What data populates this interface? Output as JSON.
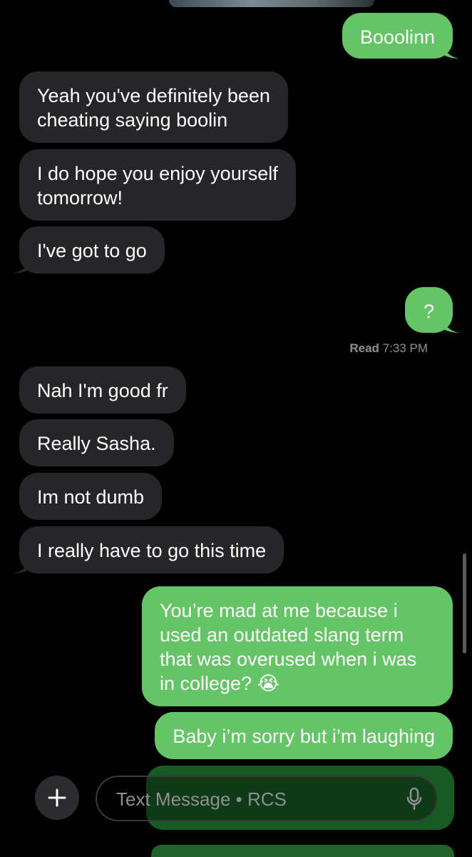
{
  "messages": [
    {
      "side": "sent",
      "text": "Booolinn"
    },
    {
      "side": "received",
      "text": "Yeah you've definitely been\ncheating saying boolin"
    },
    {
      "side": "received",
      "text": "I do hope you enjoy yourself\ntomorrow!"
    },
    {
      "side": "received",
      "text": "I've got to go"
    },
    {
      "side": "sent",
      "text": "?"
    },
    {
      "side": "received",
      "text": "Nah I'm good fr"
    },
    {
      "side": "received",
      "text": "Really Sasha."
    },
    {
      "side": "received",
      "text": "Im not dumb"
    },
    {
      "side": "received",
      "text": "I really have to go this time"
    },
    {
      "side": "sent",
      "text": "You’re mad at me because i\nused an outdated slang term\nthat was overused when i was\nin college? 😭"
    },
    {
      "side": "sent",
      "text": "Baby i’m sorry but i’m laughing"
    }
  ],
  "read_receipt": {
    "label": "Read",
    "time": "7:33 PM"
  },
  "compose": {
    "placeholder": "Text Message • RCS",
    "plus_icon": "plus-icon",
    "mic_icon": "microphone-icon"
  },
  "colors": {
    "sent_bubble": "#65c466",
    "received_bubble": "#262629",
    "background": "#000000"
  }
}
